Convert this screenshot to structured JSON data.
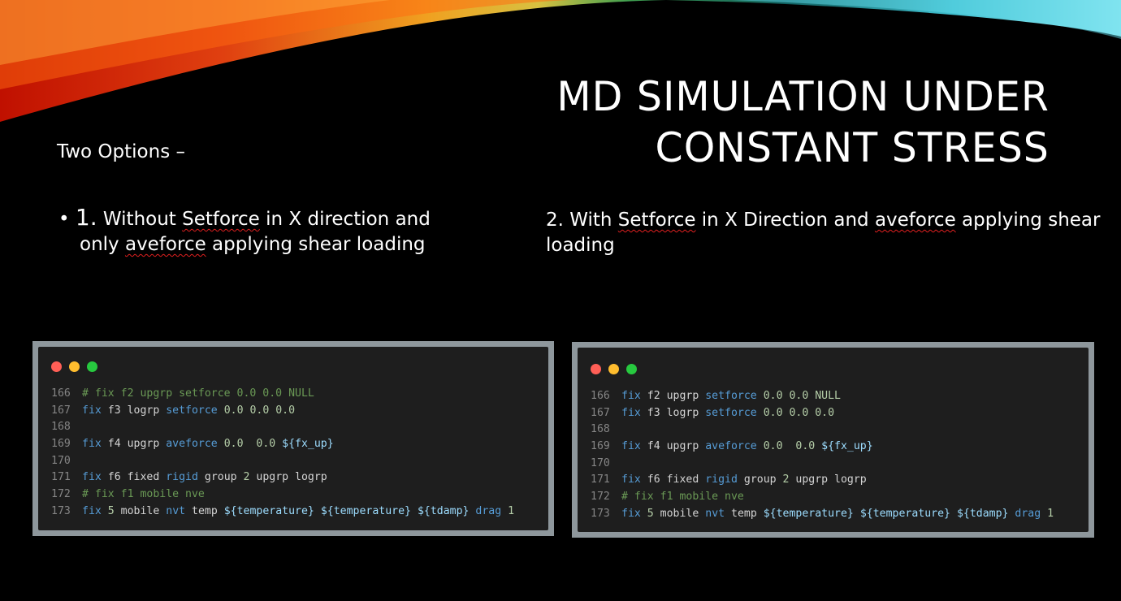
{
  "slide": {
    "title_line1": "MD SIMULATION UNDER",
    "title_line2": "CONSTANT STRESS",
    "intro": "Two Options –",
    "option1": {
      "bullet": "•",
      "number": "1.",
      "line1_a": " Without ",
      "line1_sq": "Setforce",
      "line1_b": " in X direction and",
      "line2_a": "only ",
      "line2_sq": "aveforce",
      "line2_b": " applying shear loading"
    },
    "option2": {
      "a": "2. With ",
      "sq1": "Setforce",
      "b": " in X Direction and ",
      "sq2": "aveforce",
      "c": " applying shear loading"
    }
  },
  "colors": {
    "dot_red": "#ff5f56",
    "dot_yellow": "#ffbd2e",
    "dot_green": "#27c93f",
    "keyword": "#569cd6",
    "comment": "#6a9955",
    "number": "#b5cea8",
    "variable": "#9cdcfe"
  },
  "code_blocks": [
    {
      "lines": [
        {
          "n": "166",
          "tokens": [
            [
              "cm",
              "# fix f2 upgrp setforce 0.0 0.0 NULL"
            ]
          ]
        },
        {
          "n": "167",
          "tokens": [
            [
              "kw",
              "fix"
            ],
            [
              "id",
              " f3 logrp "
            ],
            [
              "kw",
              "setforce"
            ],
            [
              "num",
              " 0.0 0.0 0.0"
            ]
          ]
        },
        {
          "n": "168",
          "tokens": []
        },
        {
          "n": "169",
          "tokens": [
            [
              "kw",
              "fix"
            ],
            [
              "id",
              " f4 upgrp "
            ],
            [
              "kw",
              "aveforce"
            ],
            [
              "num",
              " 0.0  0.0 "
            ],
            [
              "var",
              "${fx_up}"
            ]
          ]
        },
        {
          "n": "170",
          "tokens": []
        },
        {
          "n": "171",
          "tokens": [
            [
              "kw",
              "fix"
            ],
            [
              "id",
              " f6 fixed "
            ],
            [
              "kw",
              "rigid"
            ],
            [
              "id",
              " group "
            ],
            [
              "num",
              "2"
            ],
            [
              "id",
              " upgrp logrp"
            ]
          ]
        },
        {
          "n": "172",
          "tokens": [
            [
              "cm",
              "# fix f1 mobile nve"
            ]
          ]
        },
        {
          "n": "173",
          "tokens": [
            [
              "kw",
              "fix"
            ],
            [
              "num",
              " 5"
            ],
            [
              "id",
              " mobile "
            ],
            [
              "kw",
              "nvt"
            ],
            [
              "id",
              " temp "
            ],
            [
              "var",
              "${temperature}"
            ],
            [
              "id",
              " "
            ],
            [
              "var",
              "${temperature}"
            ],
            [
              "id",
              " "
            ],
            [
              "var",
              "${tdamp}"
            ],
            [
              "kw",
              " drag"
            ],
            [
              "num",
              " 1"
            ]
          ]
        }
      ]
    },
    {
      "lines": [
        {
          "n": "166",
          "tokens": [
            [
              "kw",
              "fix"
            ],
            [
              "id",
              " f2 upgrp "
            ],
            [
              "kw",
              "setforce"
            ],
            [
              "num",
              " 0.0 0.0 NULL"
            ]
          ]
        },
        {
          "n": "167",
          "tokens": [
            [
              "kw",
              "fix"
            ],
            [
              "id",
              " f3 logrp "
            ],
            [
              "kw",
              "setforce"
            ],
            [
              "num",
              " 0.0 0.0 0.0"
            ]
          ]
        },
        {
          "n": "168",
          "tokens": []
        },
        {
          "n": "169",
          "tokens": [
            [
              "kw",
              "fix"
            ],
            [
              "id",
              " f4 upgrp "
            ],
            [
              "kw",
              "aveforce"
            ],
            [
              "num",
              " 0.0  0.0 "
            ],
            [
              "var",
              "${fx_up}"
            ]
          ]
        },
        {
          "n": "170",
          "tokens": []
        },
        {
          "n": "171",
          "tokens": [
            [
              "kw",
              "fix"
            ],
            [
              "id",
              " f6 fixed "
            ],
            [
              "kw",
              "rigid"
            ],
            [
              "id",
              " group "
            ],
            [
              "num",
              "2"
            ],
            [
              "id",
              " upgrp logrp"
            ]
          ]
        },
        {
          "n": "172",
          "tokens": [
            [
              "cm",
              "# fix f1 mobile nve"
            ]
          ]
        },
        {
          "n": "173",
          "tokens": [
            [
              "kw",
              "fix"
            ],
            [
              "num",
              " 5"
            ],
            [
              "id",
              " mobile "
            ],
            [
              "kw",
              "nvt"
            ],
            [
              "id",
              " temp "
            ],
            [
              "var",
              "${temperature}"
            ],
            [
              "id",
              " "
            ],
            [
              "var",
              "${temperature}"
            ],
            [
              "id",
              " "
            ],
            [
              "var",
              "${tdamp}"
            ],
            [
              "kw",
              " drag"
            ],
            [
              "num",
              " 1"
            ]
          ]
        }
      ]
    }
  ]
}
